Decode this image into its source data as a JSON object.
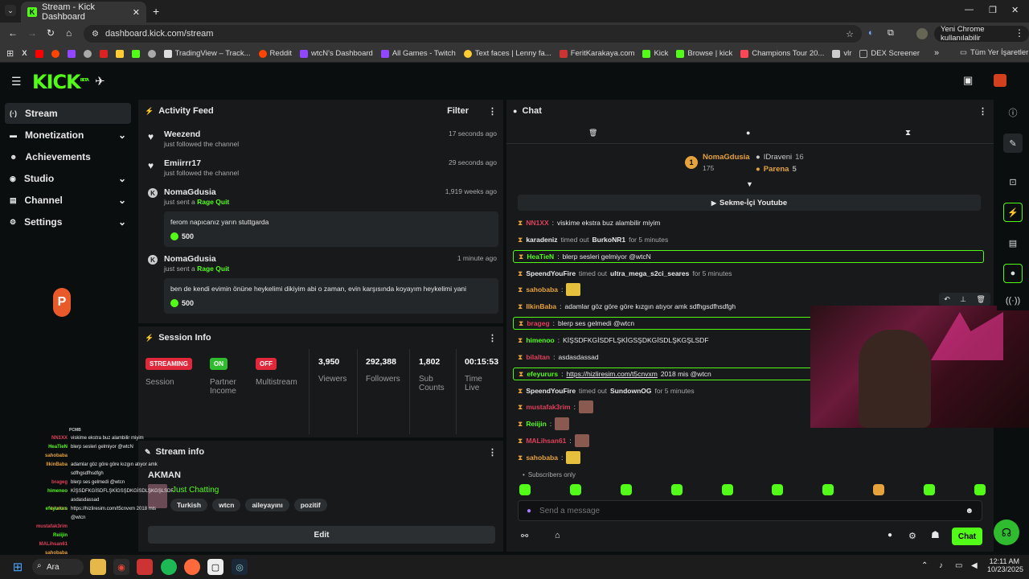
{
  "browser": {
    "tab_title": "Stream - Kick Dashboard",
    "url": "dashboard.kick.com/stream",
    "profile_label": "Yeni Chrome kullanılabilir",
    "bookmarks": [
      "TradingView – Track...",
      "Reddit",
      "wtcN's Dashboard",
      "All Games - Twitch",
      "Text faces | Lenny fa...",
      "FeritKarakaya.com",
      "Kick",
      "Browse | kick",
      "Champions Tour 20...",
      "vlr",
      "DEX Screener"
    ],
    "all_bookmarks": "Tüm Yer İşaretleri"
  },
  "app": {
    "logo": "KICK",
    "logo_sup": "BETA"
  },
  "nav": [
    {
      "label": "Stream",
      "icon": "(·)"
    },
    {
      "label": "Monetization",
      "icon": "▬"
    },
    {
      "label": "Achievements",
      "icon": "☻"
    },
    {
      "label": "Studio",
      "icon": "◉"
    },
    {
      "label": "Channel",
      "icon": "▤"
    },
    {
      "label": "Settings",
      "icon": "⚙"
    }
  ],
  "activity": {
    "title": "Activity Feed",
    "filter": "Filter",
    "items": [
      {
        "name": "Weezend",
        "sub": "just followed the channel",
        "time": "17 seconds ago"
      },
      {
        "name": "Emiirrr17",
        "sub": "just followed the channel",
        "time": "29 seconds ago"
      },
      {
        "name": "NomaGdusia",
        "sub": "just sent a",
        "sub_hl": "Rage Quit",
        "time": "1,919 weeks ago",
        "msg": "ferom napıcanız yarın stuttgarda",
        "amount": "500"
      },
      {
        "name": "NomaGdusia",
        "sub": "just sent a",
        "sub_hl": "Rage Quit",
        "time": "1 minute ago",
        "msg": "ben de kendi evimin önüne heykelimi dikiyim abi o zaman, evin karşısında koyayım heykelimi yani",
        "amount": "500"
      }
    ]
  },
  "session": {
    "title": "Session Info",
    "badges": [
      {
        "value": "STREAMING",
        "label": "Session",
        "color": "#e0283a"
      },
      {
        "value": "ON",
        "label": "Partner Income",
        "color": "#2fbd2f"
      },
      {
        "value": "OFF",
        "label": "Multistream",
        "color": "#e0283a"
      }
    ],
    "stats": [
      {
        "value": "3,950",
        "label": "Viewers"
      },
      {
        "value": "292,388",
        "label": "Followers"
      },
      {
        "value": "1,802",
        "label": "Sub Counts"
      },
      {
        "value": "00:15:53",
        "label": "Time Live"
      }
    ]
  },
  "stream_info": {
    "title": "Stream info",
    "stream_title": "AKMAN",
    "category": "Just Chatting",
    "tags": [
      "Turkish",
      "wtcn",
      "aileyayını",
      "pozitif"
    ],
    "edit": "Edit"
  },
  "chat": {
    "title": "Chat",
    "leaderboard": [
      {
        "rank": "1",
        "name": "NomaGdusia",
        "count": "175"
      },
      {
        "name": "IDraveni",
        "count": "16"
      },
      {
        "name": "Parena",
        "count": "5"
      }
    ],
    "pinned": "Sekme-İçi Youtube",
    "messages": [
      {
        "user": "NN1XX",
        "color": "#e0405a",
        "text": "viskime ekstra buz alambilir miyim"
      },
      {
        "mod": "karadeniz",
        "text1": "timed out",
        "target": "BurkoNR1",
        "text2": "for 5 minutes"
      },
      {
        "user": "HeaTieN",
        "color": "#53fc18",
        "text": "blerp sesleri gelmiyor @wtcN",
        "hl": true
      },
      {
        "mod": "SpeendYouFire",
        "text1": "timed out",
        "target": "ultra_mega_s2ci_seares",
        "text2": "for 5 minutes"
      },
      {
        "user": "sahobaba",
        "color": "#e6a23c",
        "text": ""
      },
      {
        "user": "IlkinBaba",
        "color": "#e6a23c",
        "text": "adamlar göz göre göre kızgın atıyor amk sdfhgsdfhsdfgh"
      },
      {
        "user": "brageg",
        "color": "#e0405a",
        "text": "blerp ses gelmedi @wtcn",
        "hl": true
      },
      {
        "user": "himenoo",
        "color": "#53fc18",
        "text": "KİŞSDFKGİSDFLŞKİGSŞDKGİSDLŞKGŞLSDF"
      },
      {
        "user": "bilaltan",
        "color": "#e0405a",
        "text": "asdasdassad"
      },
      {
        "user": "efeyururs",
        "color": "#53fc18",
        "text": "https://hizliresim.com/t5cnvxm",
        "text2": "2018 mis @wtcn",
        "hl": true
      },
      {
        "mod": "SpeendYouFire",
        "text1": "timed out",
        "target": "SundownOG",
        "text2": "for 5 minutes"
      },
      {
        "user": "mustafak3rim",
        "color": "#e0405a",
        "text": ""
      },
      {
        "user": "Reiijin",
        "color": "#53fc18",
        "text": ""
      },
      {
        "user": "MALihsan61",
        "color": "#e0405a",
        "text": ""
      },
      {
        "user": "sahobaba",
        "color": "#e6a23c",
        "text": ""
      }
    ],
    "subscribers_only": "Subscribers only",
    "placeholder": "Send a message",
    "send_label": "Chat"
  },
  "overlay_chat": [
    {
      "user": "NN1XX",
      "text": "viskime ekstra buz alambilir miyim",
      "color": "#e0405a"
    },
    {
      "user": "HeaTieN",
      "text": "blerp sesleri gelmiyor @wtcN",
      "color": "#53fc18"
    },
    {
      "user": "sahobaba",
      "text": "",
      "color": "#e6a23c"
    },
    {
      "user": "IlkinBaba",
      "text": "adamlar göz göre göre kızgın atıyor amk",
      "color": "#e6a23c"
    },
    {
      "user": "",
      "text": "sdfhgsdfhsdfgh",
      "color": "#fff"
    },
    {
      "user": "brageg",
      "text": "blerp ses gelmedi @wtcn",
      "color": "#e0405a"
    },
    {
      "user": "himenoo",
      "text": "KİŞSDFKGİSDFLŞKİGSŞDKGİSDLŞKGŞLSDF",
      "color": "#53fc18"
    },
    {
      "user": "",
      "text": "asdasdassad",
      "color": "#fff"
    },
    {
      "user": "bilaltan",
      "text": "",
      "color": "#e0405a"
    },
    {
      "user": "efeyururs",
      "text": "https://hizliresim.com/t5cnvxm 2018 mis",
      "color": "#53fc18"
    },
    {
      "user": "",
      "text": "@wtcn",
      "color": "#fff"
    },
    {
      "user": "mustafak3rim",
      "text": "",
      "color": "#e0405a"
    },
    {
      "user": "Reiijin",
      "text": "",
      "color": "#53fc18"
    },
    {
      "user": "MALihsan61",
      "text": "",
      "color": "#e0405a"
    },
    {
      "user": "sahobaba",
      "text": "",
      "color": "#e6a23c"
    }
  ],
  "taskbar": {
    "search": "Ara",
    "time": "12:11 AM",
    "date": "10/23/2025"
  },
  "colors": {
    "accent": "#53fc18",
    "panel": "#17191b",
    "bg": "#0b0e0f"
  }
}
